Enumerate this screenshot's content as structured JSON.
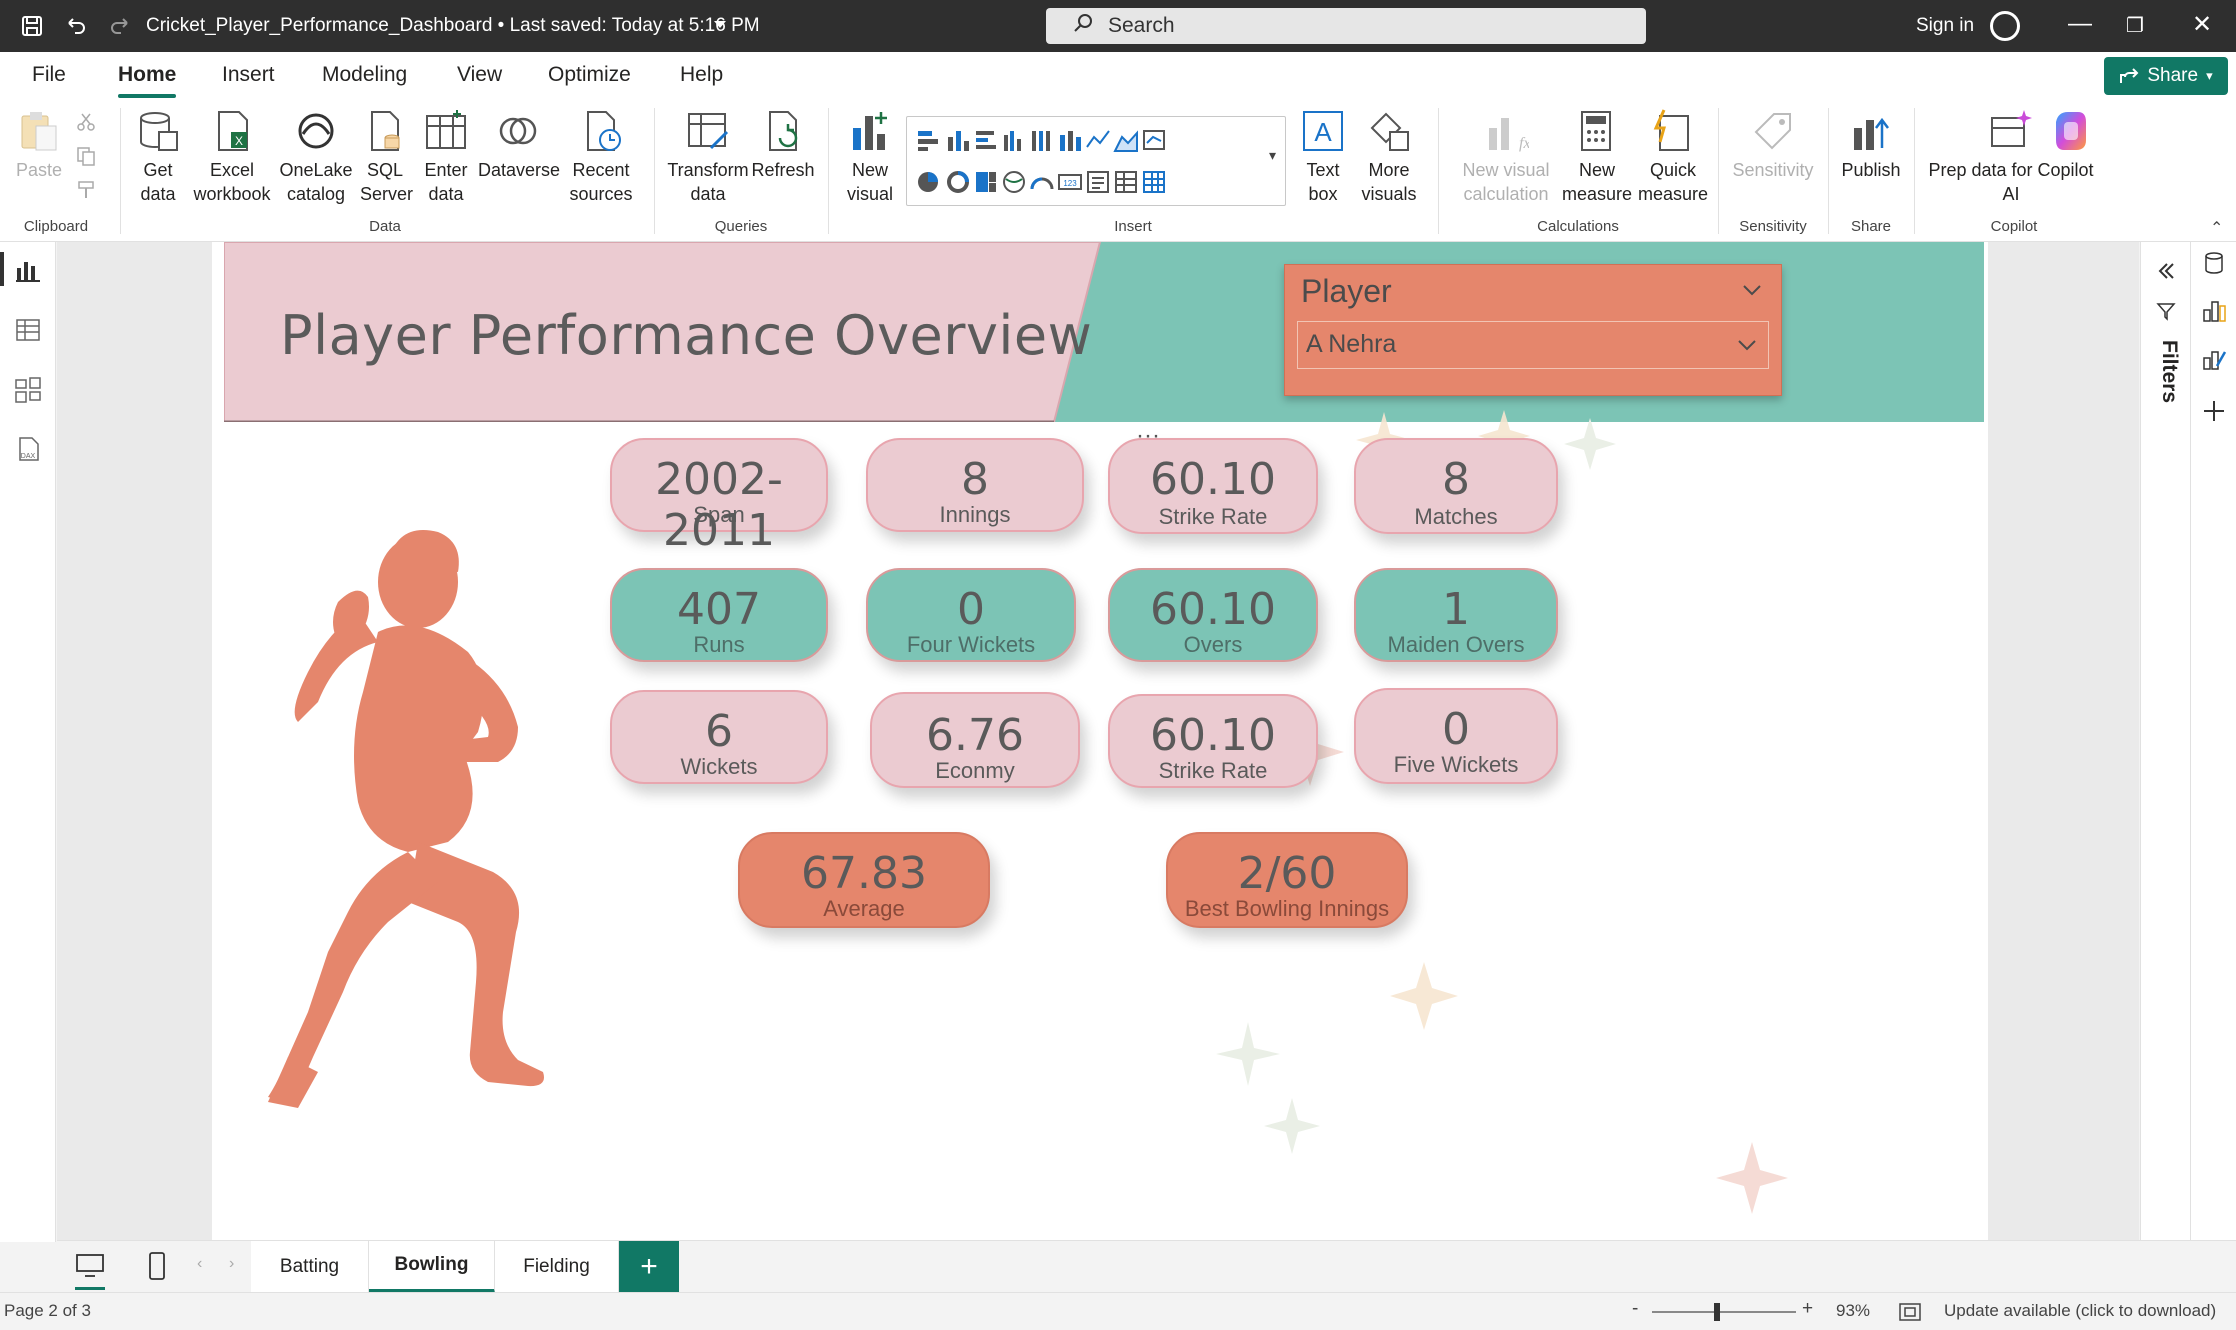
{
  "window": {
    "title": "Cricket_Player_Performance_Dashboard • Last saved: Today at 5:16 PM",
    "search_placeholder": "Search",
    "sign_in": "Sign in"
  },
  "menu": {
    "items": [
      "File",
      "Home",
      "Insert",
      "Modeling",
      "View",
      "Optimize",
      "Help"
    ],
    "active": "Home",
    "share_label": "Share"
  },
  "ribbon": {
    "clipboard": {
      "paste": "Paste",
      "group": "Clipboard"
    },
    "data": {
      "get_data": "Get data",
      "excel": "Excel workbook",
      "onelake": "OneLake catalog",
      "sql": "SQL Server",
      "enter": "Enter data",
      "dataverse": "Dataverse",
      "recent": "Recent sources",
      "group": "Data"
    },
    "queries": {
      "transform": "Transform data",
      "refresh": "Refresh",
      "group": "Queries"
    },
    "insert": {
      "new_visual": "New visual",
      "text_box": "Text box",
      "more_visuals": "More visuals",
      "group": "Insert"
    },
    "calculations": {
      "new_visual_calc": "New visual calculation",
      "new_measure": "New measure",
      "quick_measure": "Quick measure",
      "group": "Calculations"
    },
    "sensitivity": {
      "label": "Sensitivity",
      "group": "Sensitivity"
    },
    "share": {
      "publish": "Publish",
      "group": "Share"
    },
    "copilot": {
      "prep": "Prep data for Copilot AI",
      "group": "Copilot"
    }
  },
  "report": {
    "title": "Player Performance Overview",
    "slicer": {
      "title": "Player",
      "value": "A Nehra"
    },
    "cards": [
      {
        "value": "2002-2011",
        "label": "Span",
        "color": "pink"
      },
      {
        "value": "8",
        "label": "Innings",
        "color": "pink"
      },
      {
        "value": "60.10",
        "label": "Strike Rate",
        "color": "pink"
      },
      {
        "value": "8",
        "label": "Matches",
        "color": "pink"
      },
      {
        "value": "407",
        "label": "Runs",
        "color": "teal"
      },
      {
        "value": "0",
        "label": "Four Wickets",
        "color": "teal"
      },
      {
        "value": "60.10",
        "label": "Overs",
        "color": "teal"
      },
      {
        "value": "1",
        "label": "Maiden Overs",
        "color": "teal"
      },
      {
        "value": "6",
        "label": "Wickets",
        "color": "pink"
      },
      {
        "value": "6.76",
        "label": "Econmy",
        "color": "pink"
      },
      {
        "value": "60.10",
        "label": "Strike Rate",
        "color": "pink"
      },
      {
        "value": "0",
        "label": "Five Wickets",
        "color": "pink"
      },
      {
        "value": "67.83",
        "label": "Average",
        "color": "orange"
      },
      {
        "value": "2/60",
        "label": "Best Bowling Innings",
        "color": "orange"
      }
    ]
  },
  "filters_label": "Filters",
  "pages": {
    "tabs": [
      "Batting",
      "Bowling",
      "Fielding"
    ],
    "active": "Bowling"
  },
  "status": {
    "page": "Page 2 of 3",
    "zoom": "93%",
    "update": "Update available (click to download)"
  },
  "colors": {
    "accent": "#117865",
    "pink": "#ebcbd1",
    "teal": "#7cc4b5",
    "orange": "#e5866c"
  }
}
